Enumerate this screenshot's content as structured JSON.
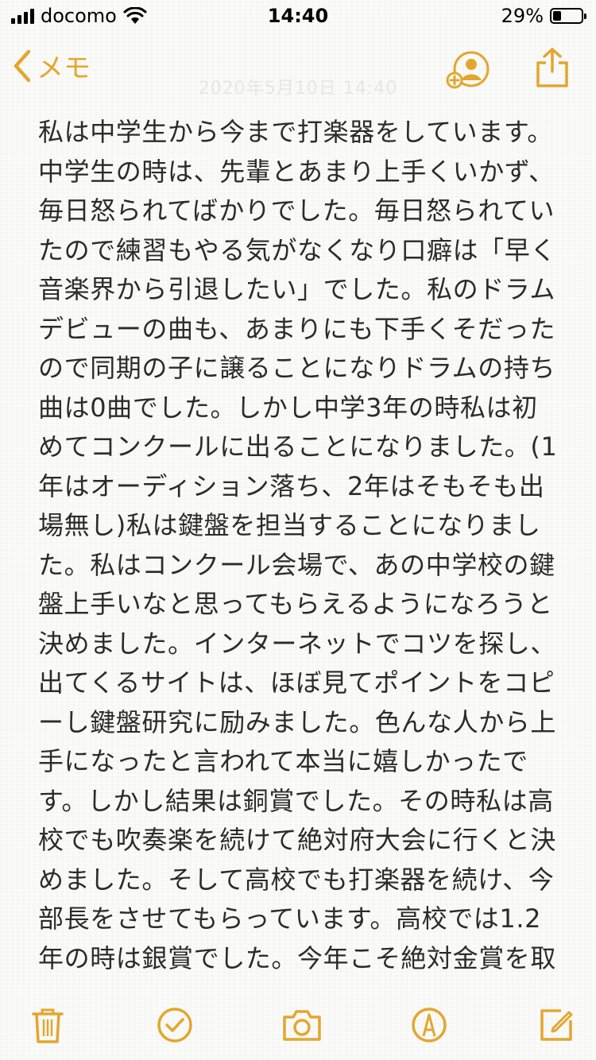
{
  "status_bar": {
    "carrier": "docomo",
    "time": "14:40",
    "battery_percent_text": "29%",
    "battery_level": 0.29
  },
  "nav": {
    "back_label": "メモ",
    "date_text": "2020年5月10日 14:40"
  },
  "note": {
    "body": "私は中学生から今まで打楽器をしています。中学生の時は、先輩とあまり上手くいかず、毎日怒られてばかりでした。毎日怒られていたので練習もやる気がなくなり口癖は「早く音楽界から引退したい」でした。私のドラムデビューの曲も、あまりにも下手くそだったので同期の子に譲ることになりドラムの持ち曲は0曲でした。しかし中学3年の時私は初めてコンクールに出ることになりました。(1年はオーディション落ち、2年はそもそも出場無し)私は鍵盤を担当することになりました。私はコンクール会場で、あの中学校の鍵盤上手いなと思ってもらえるようになろうと決めました。インターネットでコツを探し、出てくるサイトは、ほぼ見てポイントをコピーし鍵盤研究に励みました。色んな人から上手になったと言われて本当に嬉しかったです。しかし結果は銅賞でした。その時私は高校でも吹奏楽を続けて絶対府大会に行くと決めました。そして高校でも打楽器を続け、今部長をさせてもらっています。高校では1.2年の時は銀賞でした。今年こそ絶対金賞を取るというのを部活全体の目標にして、今まで頑張ってきま"
  },
  "colors": {
    "accent": "#e2a72e",
    "text": "#2b2b2b",
    "background": "#fbfbf9"
  },
  "icons": {
    "back": "chevron-left-icon",
    "collaborate": "add-person-icon",
    "share": "share-icon",
    "delete": "trash-icon",
    "checklist": "checkmark-circle-icon",
    "camera": "camera-icon",
    "markup": "pen-tip-icon",
    "compose": "compose-icon"
  }
}
